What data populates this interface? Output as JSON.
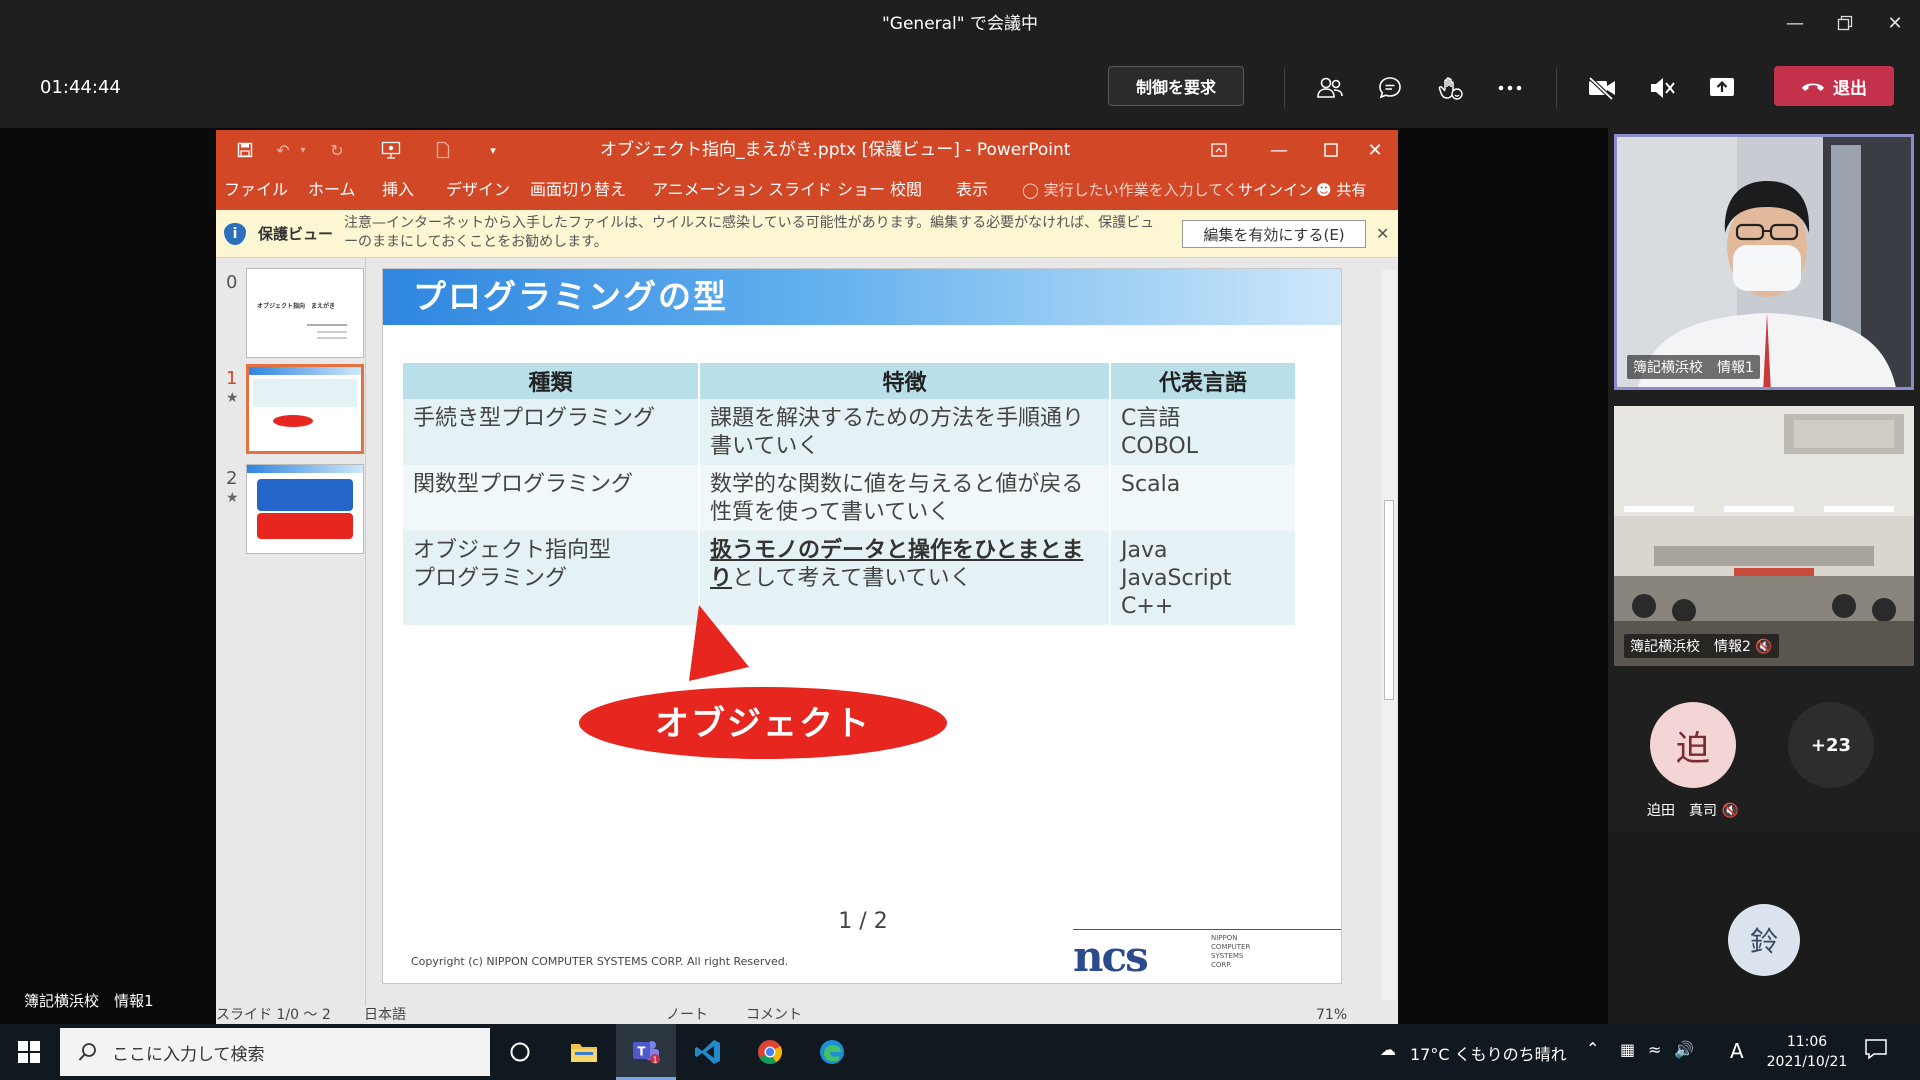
{
  "window": {
    "title": "\"General\" で会議中"
  },
  "call": {
    "timer": "01:44:44",
    "request_control": "制御を要求",
    "leave": "退出",
    "icons": [
      "people-icon",
      "chat-icon",
      "reactions-icon",
      "more-icon",
      "camera-off-icon",
      "mic-muted-icon",
      "share-icon",
      "phone-hangup-icon"
    ],
    "leave_color": "#c4314b"
  },
  "presenter_label": "簿記横浜校　情報1",
  "ppt": {
    "title": "オブジェクト指向_まえがき.pptx [保護ビュー] - PowerPoint",
    "accent": "#d24726",
    "ribbon_tabs": [
      "ファイル",
      "ホーム",
      "挿入",
      "デザイン",
      "画面切り替え",
      "アニメーション",
      "スライド ショー",
      "校閲",
      "表示"
    ],
    "tell_me": "実行したい作業を入力してく",
    "signin": "サインイン",
    "share": "共有",
    "protected_view": {
      "label": "保護ビュー",
      "message": "注意—インターネットから入手したファイルは、ウイルスに感染している可能性があります。編集する必要がなければ、保護ビューのままにしておくことをお勧めします。",
      "enable_button": "編集を有効にする(E)"
    },
    "thumbnails": [
      {
        "num": "0",
        "star": ""
      },
      {
        "num": "1",
        "star": "★"
      },
      {
        "num": "2",
        "star": "★"
      }
    ],
    "thumb0_text": "オブジェクト指向　まえがき",
    "slide": {
      "title": "プログラミングの型",
      "headers": [
        "種類",
        "特徴",
        "代表言語"
      ],
      "rows": [
        {
          "kind": "手続き型プログラミング",
          "feature": "課題を解決するための方法を手順通り書いていく",
          "langs": "C言語\nCOBOL"
        },
        {
          "kind": "関数型プログラミング",
          "feature": "数学的な関数に値を与えると値が戻る性質を使って書いていく",
          "langs": "Scala"
        },
        {
          "kind": "オブジェクト指向型\nプログラミング",
          "feature_bold": "扱うモノのデータと操作をひとまとまり",
          "feature_rest": "として考えて書いていく",
          "langs": "Java\nJavaScript\nC++"
        }
      ],
      "callout": "オブジェクト",
      "page": "1 / 2",
      "copyright": "Copyright (c) NIPPON COMPUTER SYSTEMS CORP. All right Reserved.",
      "logo": "ncs",
      "logo_sub": "NIPPON\nCOMPUTER\nSYSTEMS\nCORP."
    },
    "status": {
      "slide": "スライド 1/0 ～ 2",
      "lang": "日本語",
      "notes": "ノート",
      "comments": "コメント",
      "zoom": "71%"
    }
  },
  "gallery": {
    "tile1_name": "簿記横浜校　情報1",
    "tile2_name": "簿記横浜校　情報2",
    "avatar1_initial": "迫",
    "avatar1_name": "迫田　真司",
    "more_count": "+23",
    "avatar2_initial": "鈴"
  },
  "taskbar": {
    "search_placeholder": "ここに入力して検索",
    "weather": "17°C  くもりのち晴れ",
    "ime": "A",
    "time": "11:06",
    "date": "2021/10/21"
  }
}
